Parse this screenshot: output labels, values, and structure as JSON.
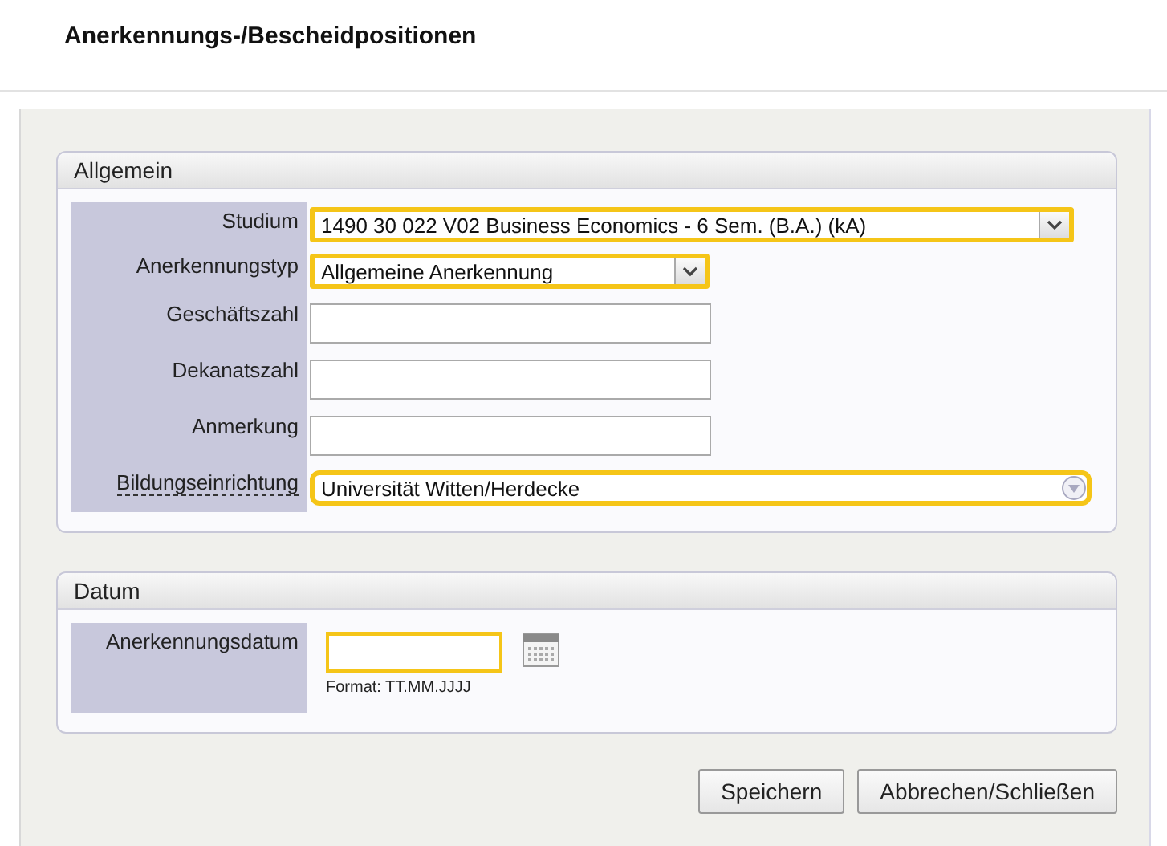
{
  "title": "Anerkennungs-/Bescheidpositionen",
  "sections": [
    {
      "title": "Allgemein",
      "fields": [
        {
          "kind": "select",
          "label": "Studium",
          "value": "1490 30 022 V02 Business Economics - 6 Sem. (B.A.) (kA)",
          "required": true,
          "wide": true
        },
        {
          "kind": "select",
          "label": "Anerkennungstyp",
          "value": "Allgemeine Anerkennung",
          "required": true,
          "wide": false
        },
        {
          "kind": "text",
          "label": "Geschäftszahl",
          "required": false
        },
        {
          "kind": "text",
          "label": "Dekanatszahl",
          "required": false
        },
        {
          "kind": "text",
          "label": "Anmerkung",
          "required": false
        },
        {
          "kind": "combo",
          "label": "Bildungseinrichtung",
          "value": "Universität Witten/Herdecke",
          "required": true
        }
      ]
    },
    {
      "title": "Datum",
      "fields": [
        {
          "kind": "date",
          "label": "Anerkennungsdatum",
          "required": true,
          "hint": "Format: TT.MM.JJJJ"
        }
      ]
    }
  ],
  "buttons": [
    "Speichern",
    "Abbrechen/Schließen"
  ]
}
